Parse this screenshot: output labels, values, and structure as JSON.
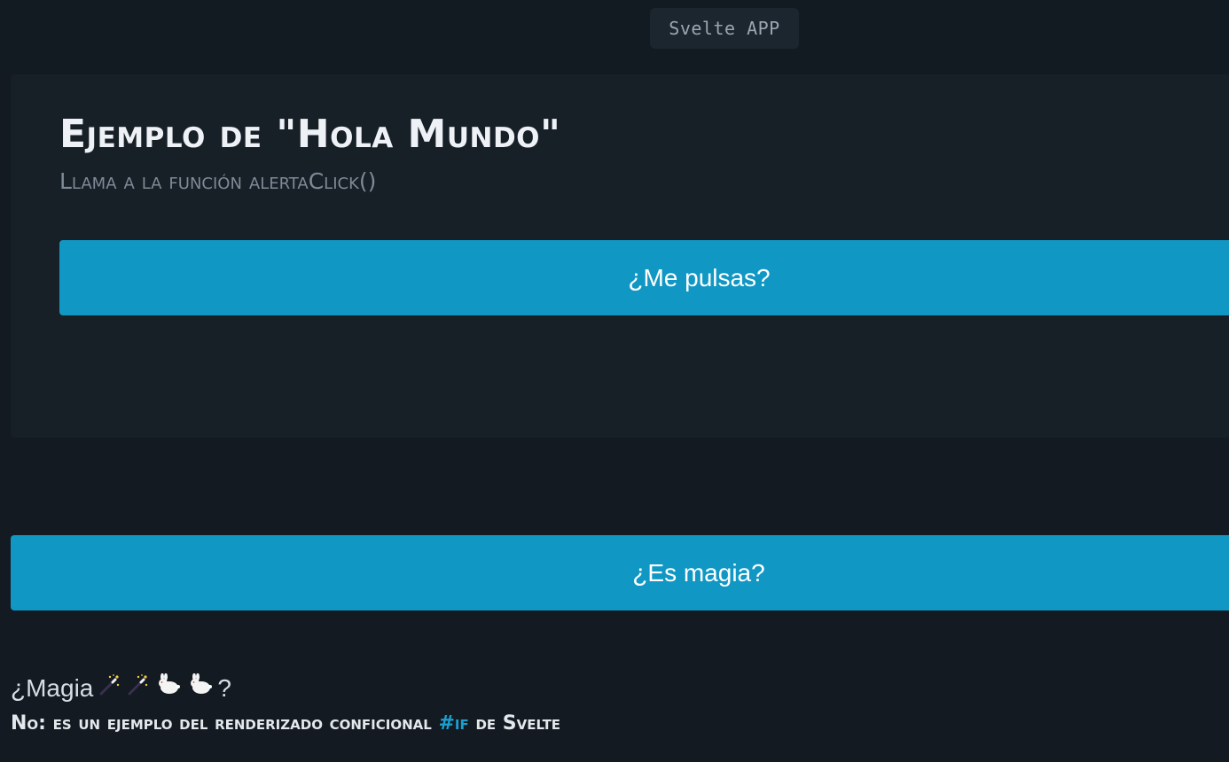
{
  "app": {
    "badge_label": "Svelte APP"
  },
  "card": {
    "title": "Ejemplo de \"Hola Mundo\"",
    "subtitle": "Llama a la función alertaClick()",
    "button_label": "¿Me pulsas?"
  },
  "magic": {
    "button_label": "¿Es magia?",
    "question_prefix": "¿Magia",
    "question_suffix": "?",
    "icons": [
      "magic-wand-icon",
      "magic-wand-icon",
      "rabbit-icon",
      "rabbit-icon"
    ]
  },
  "note": {
    "lead": "No:",
    "text_before": "es un ejemplo del renderizado conficional",
    "keyword": "#if",
    "text_after": "de Svelte"
  },
  "colors": {
    "background": "#131a21",
    "card": "#171f27",
    "accent": "#1197c4",
    "keyword": "#1a9fd0"
  }
}
